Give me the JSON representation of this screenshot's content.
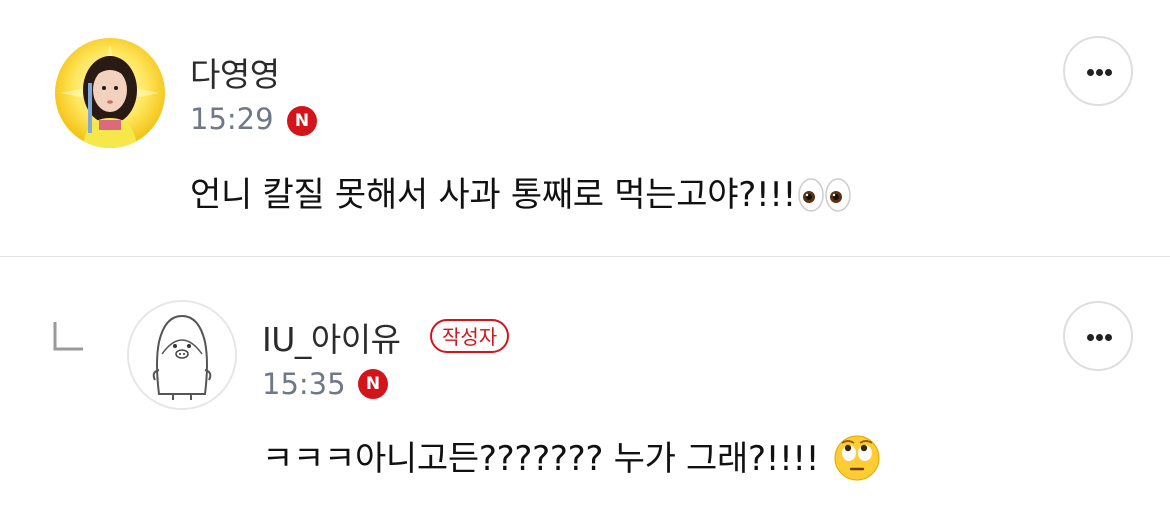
{
  "comments": [
    {
      "author": "다영영",
      "time": "15:29",
      "network_badge": "N",
      "text": "언니 칼질 못해서 사과 통째로 먹는고야?!!!",
      "emoji": "eyes-emoji",
      "is_reply": false
    },
    {
      "author": "IU_아이유",
      "author_badge": "작성자",
      "time": "15:35",
      "network_badge": "N",
      "text": "ㅋㅋㅋ아니고든??????? 누가 그래?!!!!",
      "emoji": "face-with-rolling-eyes-emoji",
      "is_reply": true
    }
  ],
  "colors": {
    "badge_red": "#d3141b",
    "timestamp_gray": "#6f7886",
    "divider": "#e3e3e3"
  }
}
